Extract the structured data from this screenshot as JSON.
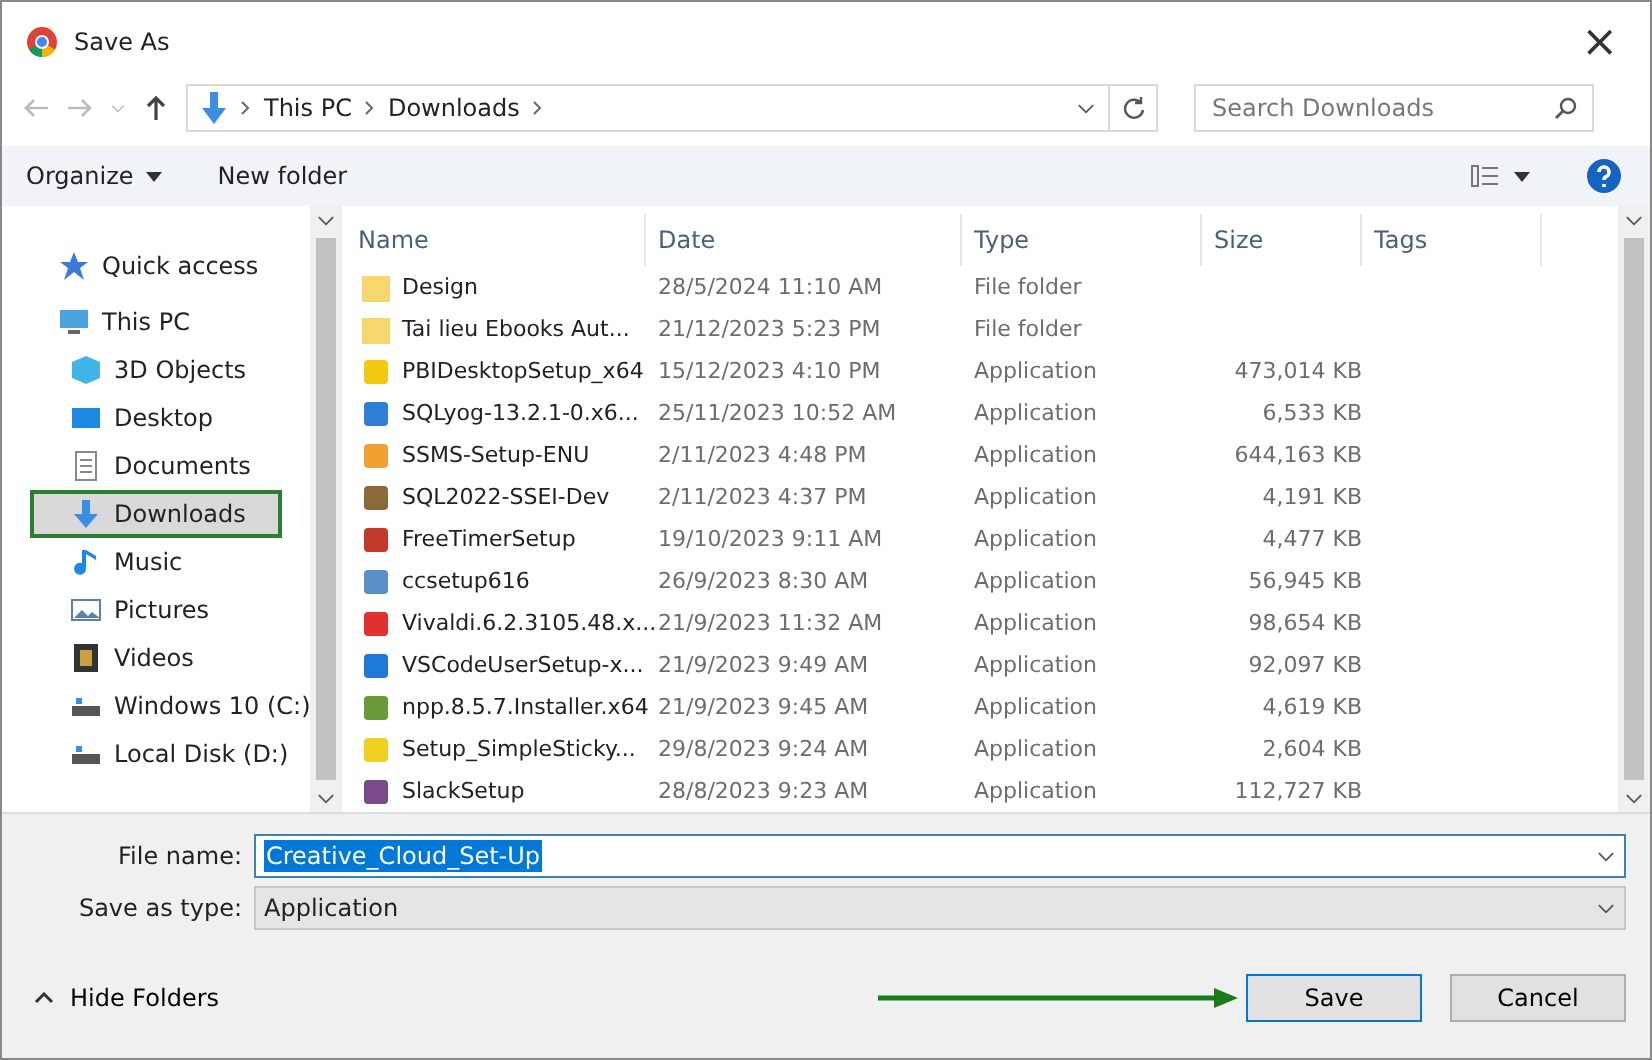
{
  "window": {
    "title": "Save As",
    "close": "×"
  },
  "address": {
    "path": [
      "This PC",
      "Downloads"
    ],
    "search_placeholder": "Search Downloads"
  },
  "toolbar": {
    "organize": "Organize",
    "new_folder": "New folder"
  },
  "sidebar": {
    "items": [
      {
        "label": "Quick access",
        "kind": "star",
        "group": true,
        "selected": false
      },
      {
        "label": "This PC",
        "kind": "pc",
        "group": true,
        "selected": false
      },
      {
        "label": "3D Objects",
        "kind": "cube",
        "group": false,
        "selected": false
      },
      {
        "label": "Desktop",
        "kind": "desktop",
        "group": false,
        "selected": false
      },
      {
        "label": "Documents",
        "kind": "doc",
        "group": false,
        "selected": false
      },
      {
        "label": "Downloads",
        "kind": "download",
        "group": false,
        "selected": true
      },
      {
        "label": "Music",
        "kind": "music",
        "group": false,
        "selected": false
      },
      {
        "label": "Pictures",
        "kind": "picture",
        "group": false,
        "selected": false
      },
      {
        "label": "Videos",
        "kind": "video",
        "group": false,
        "selected": false
      },
      {
        "label": "Windows 10 (C:)",
        "kind": "drive",
        "group": false,
        "selected": false
      },
      {
        "label": "Local Disk (D:)",
        "kind": "drive",
        "group": false,
        "selected": false
      }
    ]
  },
  "table": {
    "columns": [
      "Name",
      "Date",
      "Type",
      "Size",
      "Tags"
    ],
    "rows": [
      {
        "name": "Design",
        "date": "28/5/2024 11:10 AM",
        "type": "File folder",
        "size": "",
        "kind": "folder",
        "color": "#f5d76e"
      },
      {
        "name": "Tai lieu Ebooks Aut...",
        "date": "21/12/2023 5:23 PM",
        "type": "File folder",
        "size": "",
        "kind": "folder",
        "color": "#f5d76e"
      },
      {
        "name": "PBIDesktopSetup_x64",
        "date": "15/12/2023 4:10 PM",
        "type": "Application",
        "size": "473,014 KB",
        "kind": "app",
        "color": "#f2c811"
      },
      {
        "name": "SQLyog-13.2.1-0.x6...",
        "date": "25/11/2023 10:52 AM",
        "type": "Application",
        "size": "6,533 KB",
        "kind": "app",
        "color": "#2f7fd6"
      },
      {
        "name": "SSMS-Setup-ENU",
        "date": "2/11/2023 4:48 PM",
        "type": "Application",
        "size": "644,163 KB",
        "kind": "app",
        "color": "#f0a030"
      },
      {
        "name": "SQL2022-SSEI-Dev",
        "date": "2/11/2023 4:37 PM",
        "type": "Application",
        "size": "4,191 KB",
        "kind": "app",
        "color": "#8a6a3a"
      },
      {
        "name": "FreeTimerSetup",
        "date": "19/10/2023 9:11 AM",
        "type": "Application",
        "size": "4,477 KB",
        "kind": "app",
        "color": "#c0392b"
      },
      {
        "name": "ccsetup616",
        "date": "26/9/2023 8:30 AM",
        "type": "Application",
        "size": "56,945 KB",
        "kind": "app",
        "color": "#5b8fc7"
      },
      {
        "name": "Vivaldi.6.2.3105.48.x...",
        "date": "21/9/2023 11:32 AM",
        "type": "Application",
        "size": "98,654 KB",
        "kind": "app",
        "color": "#e03030"
      },
      {
        "name": "VSCodeUserSetup-x...",
        "date": "21/9/2023 9:49 AM",
        "type": "Application",
        "size": "92,097 KB",
        "kind": "app",
        "color": "#1e7ad6"
      },
      {
        "name": "npp.8.5.7.Installer.x64",
        "date": "21/9/2023 9:45 AM",
        "type": "Application",
        "size": "4,619 KB",
        "kind": "app",
        "color": "#6a9a3a"
      },
      {
        "name": "Setup_SimpleSticky...",
        "date": "29/8/2023 9:24 AM",
        "type": "Application",
        "size": "2,604 KB",
        "kind": "app",
        "color": "#f0d020"
      },
      {
        "name": "SlackSetup",
        "date": "28/8/2023 9:23 AM",
        "type": "Application",
        "size": "112,727 KB",
        "kind": "app",
        "color": "#7a4a8a"
      }
    ]
  },
  "form": {
    "file_name_label": "File name:",
    "file_name": "Creative_Cloud_Set-Up",
    "type_label": "Save as type:",
    "type": "Application"
  },
  "footer": {
    "hide_folders": "Hide Folders",
    "save": "Save",
    "cancel": "Cancel"
  }
}
